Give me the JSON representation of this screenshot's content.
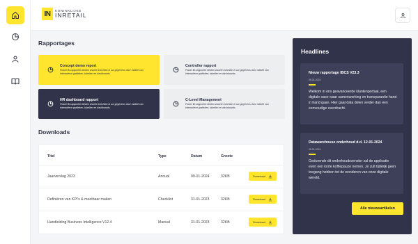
{
  "brand": {
    "mark": "IN",
    "line1": "KONINKLIJKE",
    "line2": "INRETAIL"
  },
  "rail": {
    "items": [
      {
        "icon": "home-icon",
        "active": true
      },
      {
        "icon": "chart-pie-icon",
        "active": false
      },
      {
        "icon": "user-icon",
        "active": false
      },
      {
        "icon": "book-icon",
        "active": false
      }
    ]
  },
  "header": {
    "user_icon": "user-icon"
  },
  "rapportages": {
    "title": "Rapportages",
    "cards": [
      {
        "title": "Concept demo report",
        "desc": "Power BI-rapporten bieden visuele inzichten in uw gegevens door middel van interactieve grafieken, tabellen en dashboards.",
        "style": "yellow"
      },
      {
        "title": "Controller rapport",
        "desc": "Power BI-rapporten bieden visuele inzichten in uw gegevens door middel van interactieve grafieken, tabellen en dashboards.",
        "style": "light"
      },
      {
        "title": "HR dashboard rapport",
        "desc": "Power BI-rapporten bieden visuele inzichten in uw gegevens door middel van interactieve grafieken, tabellen en dashboards.",
        "style": "dark"
      },
      {
        "title": "C-Level Management",
        "desc": "Power BI-rapporten bieden visuele inzichten in uw gegevens door middel van interactieve grafieken, tabellen en dashboards.",
        "style": "light"
      }
    ]
  },
  "downloads": {
    "title": "Downloads",
    "columns": [
      "Titel",
      "Type",
      "Datum",
      "Groote"
    ],
    "button_label": "Download",
    "rows": [
      {
        "titel": "Jaarverslag 2023",
        "type": "Annual",
        "datum": "09-01-2024",
        "grootte": "32KB"
      },
      {
        "titel": "Definiëren van KPI's & meetbaar maken",
        "type": "Checklist",
        "datum": "31-01-2023",
        "grootte": "32KB"
      },
      {
        "titel": "Handleiding Business Intelligence V12.4",
        "type": "Manual",
        "datum": "31-01-2023",
        "grootte": "32KB"
      }
    ]
  },
  "headlines": {
    "title": "Headlines",
    "items": [
      {
        "title": "Nieuw rapportage IBCS V23.3",
        "date": "09-01-2024",
        "body": "Welkom in ons geavanceerde klantenportaal, een digitale oase waar samenwerking en transparantie hand in hand gaan. Hier gaat data delen verder dan een eenvoudige overdracht."
      },
      {
        "title": "Datawarehouse onderhoud d.d. 12-01-2024",
        "date": "09-01-2024",
        "body": "Gedurende dit onderhoudsvenster zal de applicatie even een korte koffiepauze nemen. Je zult tijdelijk geen toegang hebben tot de wonderen van onze digitale wereld."
      }
    ],
    "all_button": "Alle nieuwsartikelen"
  },
  "colors": {
    "accent": "#ffe52e",
    "dark": "#30334a",
    "light_card": "#eceef0",
    "background": "#f4f5f7"
  }
}
